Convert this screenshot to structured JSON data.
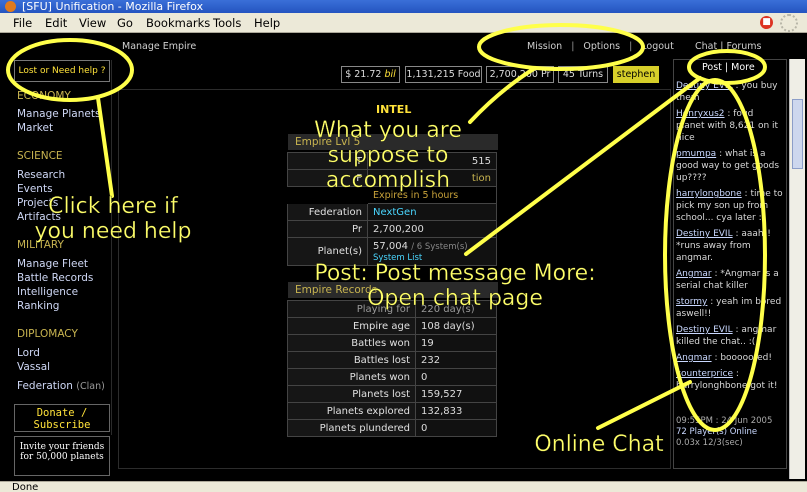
{
  "browser": {
    "window_title": "[SFU] Unification - Mozilla Firefox",
    "menu": [
      "File",
      "Edit",
      "View",
      "Go",
      "Bookmarks",
      "Tools",
      "Help"
    ],
    "status": "Done"
  },
  "top": {
    "manage_empire": "Manage Empire",
    "nav": [
      "Mission",
      "Options",
      "Logout"
    ],
    "chat_forums": "Chat | Forums"
  },
  "stats": {
    "money": "$ 21.72",
    "money_unit": "bil",
    "food": "1,131,215 Food",
    "pr": "2,700,200 Pr",
    "turns": "45 Turns",
    "user": "stephen"
  },
  "sidebar": {
    "help": "Lost or Need help ?",
    "sections": [
      {
        "heading": "ECONOMY",
        "items": [
          "Manage Planets",
          "Market"
        ]
      },
      {
        "heading": "SCIENCE",
        "items": [
          "Research",
          "Events",
          "Projects",
          "Artifacts"
        ]
      },
      {
        "heading": "MILITARY",
        "items": [
          "Manage Fleet",
          "Battle Records",
          "Intelligence",
          "Ranking"
        ]
      },
      {
        "heading": "DIPLOMACY",
        "items": [
          "Lord",
          "Vassal"
        ]
      }
    ],
    "federation": "Federation",
    "clan": "(Clan)",
    "donate": "Donate / Subscribe",
    "invite": "Invite your friends for 50,000 planets"
  },
  "main": {
    "intel_title": "INTEL",
    "panel1_head": "Empire Lvl 5",
    "faint_row": "515",
    "tion": "tion",
    "expires": "Expires in 5 hours",
    "federation_label": "Federation",
    "federation_value": "NextGen",
    "pr_label": "Pr",
    "pr_value": "2,700,200",
    "planets_label": "Planet(s)",
    "planets_value": "57,004",
    "planets_systems": "/ 6 System(s)",
    "system_list": "System List",
    "panel2_head": "Empire Records",
    "records": [
      {
        "label": "Playing for",
        "value": "220 day(s)"
      },
      {
        "label": "Empire age",
        "value": "108 day(s)"
      },
      {
        "label": "Battles won",
        "value": "19"
      },
      {
        "label": "Battles lost",
        "value": "232"
      },
      {
        "label": "Planets won",
        "value": "0"
      },
      {
        "label": "Planets lost",
        "value": "159,527"
      },
      {
        "label": "Planets explored",
        "value": "132,833"
      },
      {
        "label": "Planets plundered",
        "value": "0"
      }
    ]
  },
  "chat": {
    "buttons": "Post | More",
    "messages": [
      {
        "who": "Destiny EVIL",
        "text": ": you buy them"
      },
      {
        "who": "Henryxus2",
        "text": ": foud planet with 8,621 on it nice"
      },
      {
        "who": "pmumpa",
        "text": ": what is a good way to get goods up????"
      },
      {
        "who": "harrylongbone",
        "text": ": time to pick my son up from school... cya later :)"
      },
      {
        "who": "Destiny EVIL",
        "text": ": aaah!! *runs away from angmar."
      },
      {
        "who": "Angmar",
        "text": ": *Angmar is a serial chat killer"
      },
      {
        "who": "stormy",
        "text": ": yeah im bored aswell!!"
      },
      {
        "who": "Destiny EVIL",
        "text": ": angmar killed the chat.. :("
      },
      {
        "who": "Angmar",
        "text": ": booooored!"
      },
      {
        "who": "counterprice",
        "text": ": harrylonghbone got it!"
      }
    ],
    "time": "09:55PM : 24 Jun 2005",
    "players": "72 Player(s) Online",
    "rate": "0.03x 12/3(sec)"
  },
  "annotations": {
    "help": "Click here if you need help",
    "mission": "What you are suppose to accomplish",
    "post": "Post: Post message More: Open chat page",
    "chat": "Online Chat"
  },
  "colors": {
    "annotation": "#ffff6a",
    "gold": "#ffe23a",
    "heading": "#c8b450"
  }
}
